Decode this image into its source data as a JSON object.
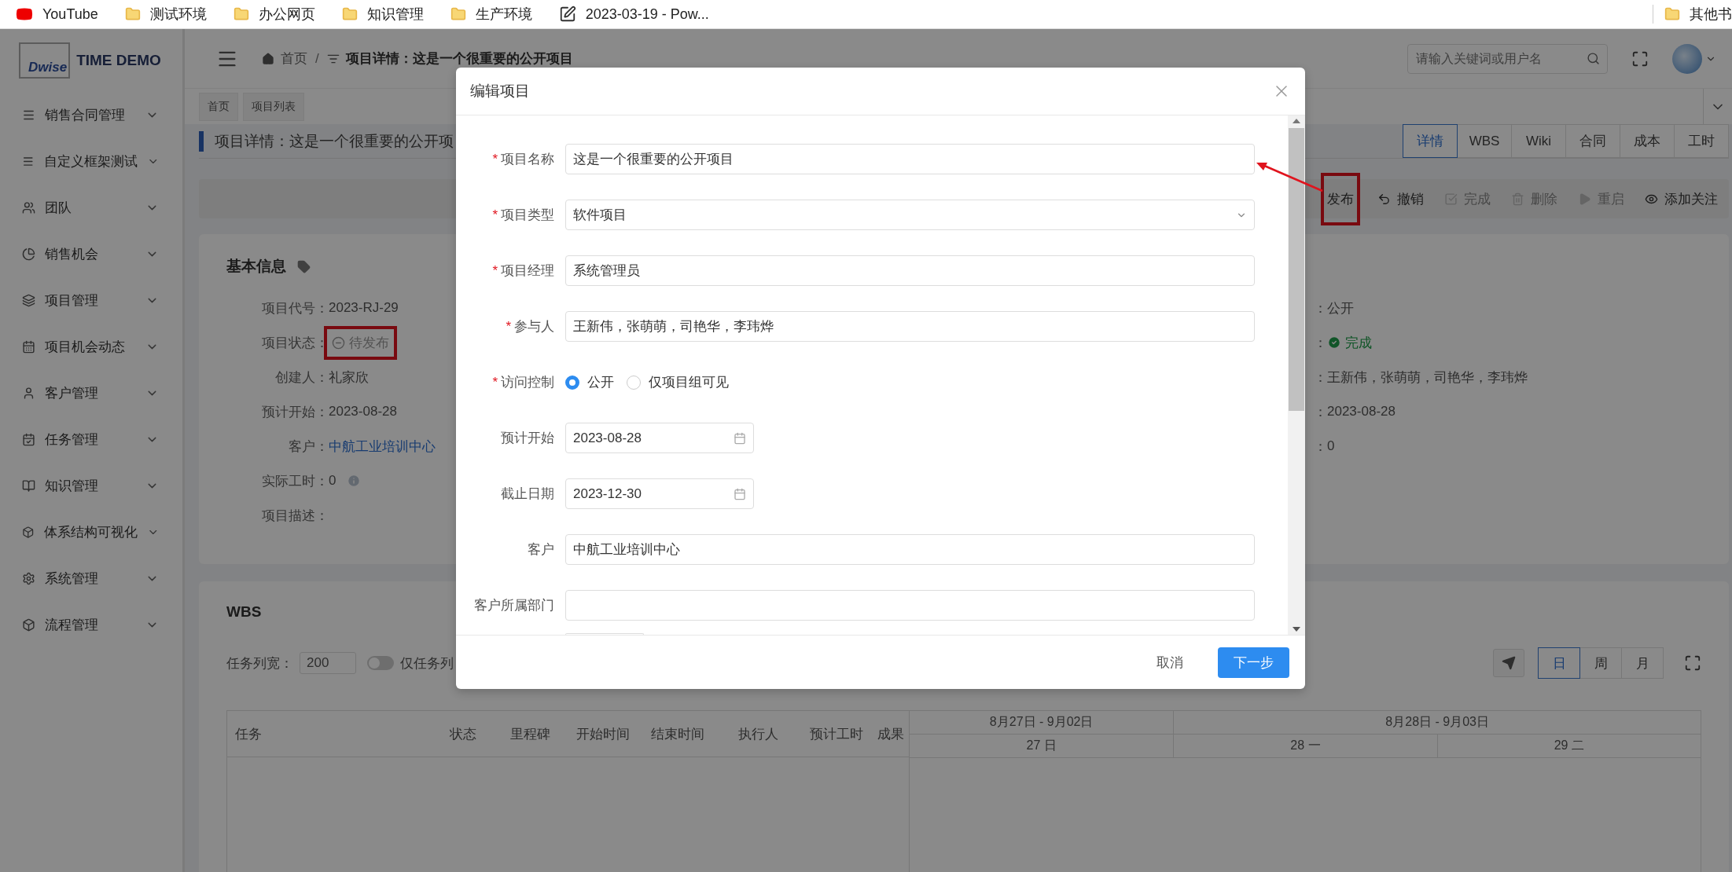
{
  "bookmarks": [
    {
      "kind": "youtube",
      "label": "YouTube"
    },
    {
      "kind": "folder",
      "label": "测试环境"
    },
    {
      "kind": "folder",
      "label": "办公网页"
    },
    {
      "kind": "folder",
      "label": "知识管理"
    },
    {
      "kind": "folder",
      "label": "生产环境"
    },
    {
      "kind": "note",
      "label": "2023-03-19 - Pow..."
    }
  ],
  "bookmarks_other": {
    "label": "其他书"
  },
  "logo": {
    "mark": "Dwise",
    "title": "TIME DEMO"
  },
  "sidebar": {
    "items": [
      {
        "label": "销售合同管理"
      },
      {
        "label": "自定义框架测试"
      },
      {
        "label": "团队"
      },
      {
        "label": "销售机会"
      },
      {
        "label": "项目管理"
      },
      {
        "label": "项目机会动态"
      },
      {
        "label": "客户管理"
      },
      {
        "label": "任务管理"
      },
      {
        "label": "知识管理"
      },
      {
        "label": "体系结构可视化"
      },
      {
        "label": "系统管理"
      },
      {
        "label": "流程管理"
      }
    ]
  },
  "header": {
    "breadcrumb": [
      {
        "label": "首页"
      },
      {
        "label": "项目详情：这是一个很重要的公开项目"
      }
    ],
    "separator": "/",
    "search": {
      "placeholder": "请输入关键词或用户名"
    }
  },
  "tag_bar": {
    "tags": [
      {
        "label": "首页"
      },
      {
        "label": "项目列表"
      }
    ]
  },
  "page_title": "项目详情：这是一个很重要的公开项",
  "tabs": [
    {
      "label": "详情",
      "selected": true
    },
    {
      "label": "WBS",
      "selected": false
    },
    {
      "label": "Wiki",
      "selected": false
    },
    {
      "label": "合同",
      "selected": false
    },
    {
      "label": "成本",
      "selected": false
    },
    {
      "label": "工时",
      "selected": false
    }
  ],
  "actions": [
    {
      "kind": "publish",
      "label": "发布",
      "disabled": false,
      "highlighted": true
    },
    {
      "kind": "undo",
      "label": "撤销",
      "disabled": false,
      "highlighted": false
    },
    {
      "kind": "complete",
      "label": "完成",
      "disabled": true,
      "highlighted": false
    },
    {
      "kind": "delete",
      "label": "删除",
      "disabled": true,
      "highlighted": false
    },
    {
      "kind": "restart",
      "label": "重启",
      "disabled": true,
      "highlighted": false
    },
    {
      "kind": "watch",
      "label": "添加关注",
      "disabled": false,
      "highlighted": false
    }
  ],
  "basic_info": {
    "title": "基本信息",
    "left": [
      {
        "kind": "text",
        "label": "项目代号：",
        "value": "2023-RJ-29"
      },
      {
        "kind": "pending",
        "label": "项目状态：",
        "value": "待发布",
        "highlighted": true
      },
      {
        "kind": "text",
        "label": "创建人：",
        "value": "礼家欣"
      },
      {
        "kind": "text",
        "label": "预计开始：",
        "value": "2023-08-28"
      },
      {
        "kind": "link",
        "label": "客户：",
        "value": "中航工业培训中心"
      },
      {
        "kind": "info",
        "label": "实际工时：",
        "value": "0"
      },
      {
        "kind": "text",
        "label": "项目描述："
      }
    ],
    "right": [
      {
        "kind": "text",
        "label": "：",
        "value": "公开"
      },
      {
        "kind": "done",
        "label": "：",
        "value": "完成",
        "highlighted": false
      },
      {
        "kind": "text",
        "label": "：",
        "value": "王新伟，张萌萌，司艳华，李玮烨"
      },
      {
        "kind": "text",
        "label": "：",
        "value": "2023-08-28"
      },
      {
        "kind": "text",
        "label": "：",
        "value": "0"
      }
    ]
  },
  "wbs": {
    "title": "WBS",
    "width_label": "任务列宽：",
    "width_value": "200",
    "task_only": {
      "label": "仅任务列",
      "on": false
    },
    "scales": [
      {
        "label": "日",
        "selected": true
      },
      {
        "label": "周",
        "selected": false
      },
      {
        "label": "月",
        "selected": false
      }
    ],
    "columns": [
      "任务",
      "状态",
      "里程碑",
      "开始时间",
      "结束时间",
      "执行人",
      "预计工时",
      "成果"
    ],
    "weeks": [
      {
        "label": "8月27日 - 9月02日"
      },
      {
        "label": "8月28日 - 9月03日"
      }
    ],
    "days": [
      "27 日",
      "28 一",
      "29 二"
    ]
  },
  "modal": {
    "title": "编辑项目",
    "required_mark": "*",
    "fields": [
      {
        "kind": "text",
        "label": "项目名称",
        "required": true,
        "value": "这是一个很重要的公开项目"
      },
      {
        "kind": "select",
        "label": "项目类型",
        "required": true,
        "value": "软件项目"
      },
      {
        "kind": "text",
        "label": "项目经理",
        "required": true,
        "value": "系统管理员"
      },
      {
        "kind": "text",
        "label": "参与人",
        "required": true,
        "value": "王新伟，张萌萌，司艳华，李玮烨"
      },
      {
        "kind": "radio",
        "label": "访问控制",
        "required": true,
        "options": [
          {
            "label": "公开",
            "selected": true
          },
          {
            "label": "仅项目组可见",
            "selected": false
          }
        ]
      },
      {
        "kind": "date",
        "label": "预计开始",
        "required": false,
        "value": "2023-08-28"
      },
      {
        "kind": "date",
        "label": "截止日期",
        "required": false,
        "value": "2023-12-30"
      },
      {
        "kind": "text",
        "label": "客户",
        "required": false,
        "value": "中航工业培训中心"
      },
      {
        "kind": "text",
        "label": "客户所属部门",
        "required": false
      }
    ],
    "buttons": [
      {
        "kind": "cancel",
        "label": "取消"
      },
      {
        "kind": "primary",
        "label": "下一步"
      }
    ]
  }
}
